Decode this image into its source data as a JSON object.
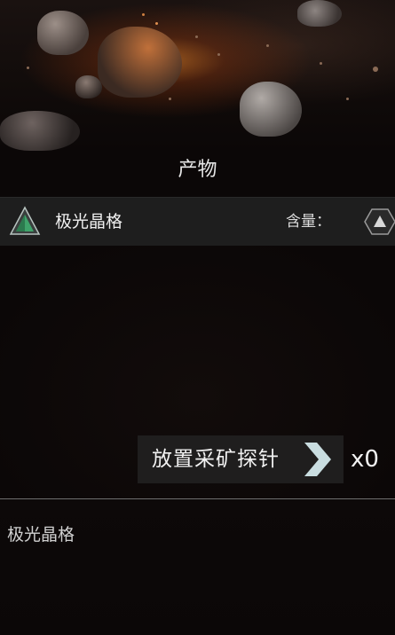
{
  "panel": {
    "title": "产物"
  },
  "product": {
    "name": "极光晶格",
    "content_label": "含量：",
    "icon": "green-pyramid-icon",
    "content_icon": "hexagon-grade-icon"
  },
  "probe_action": {
    "label": "放置采矿探针",
    "icon": "chevron-right-icon",
    "count": "x0"
  },
  "description": {
    "text": "极光晶格"
  },
  "colors": {
    "background": "#0b0707",
    "row_bg": "#1e1e1e",
    "accent_green": "#3fa36a",
    "chevron": "#c9dde0"
  }
}
